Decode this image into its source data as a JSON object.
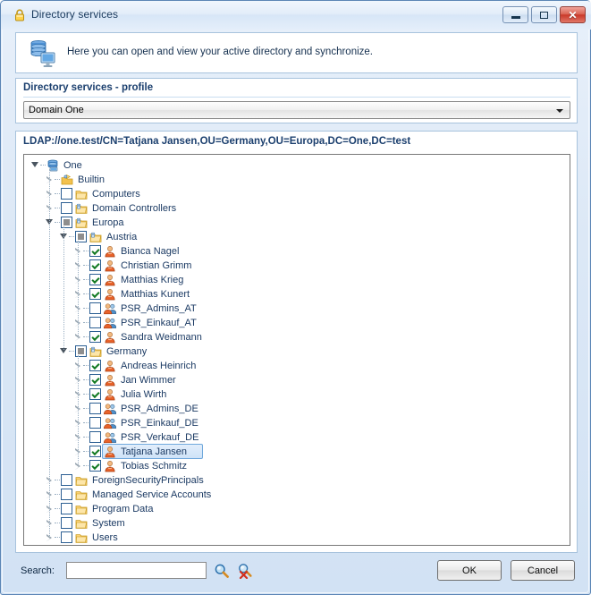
{
  "window": {
    "title": "Directory services",
    "title_icon": "lock-icon",
    "controls": {
      "minimize": "minimize-icon",
      "maximize": "maximize-icon",
      "close": "✕"
    }
  },
  "banner": {
    "icon": "database-server-monitor-icon",
    "text": "Here you can open and view your active directory and synchronize."
  },
  "profile_group": {
    "title": "Directory services - profile",
    "combo": {
      "value": "Domain One",
      "arrow": "chevron-down-icon"
    }
  },
  "ldap_group": {
    "title": "LDAP://one.test/CN=Tatjana Jansen,OU=Germany,OU=Europa,DC=One,DC=test"
  },
  "tree": [
    {
      "label": "One",
      "depth": 0,
      "icon": "server-icon",
      "checkbox": "none",
      "twisty": "expanded",
      "selected": false
    },
    {
      "label": "Builtin",
      "depth": 1,
      "icon": "builtin-folder-icon",
      "checkbox": "none",
      "twisty": "collapsed",
      "selected": false
    },
    {
      "label": "Computers",
      "depth": 1,
      "icon": "folder-icon",
      "checkbox": "unchecked",
      "twisty": "collapsed",
      "selected": false
    },
    {
      "label": "Domain Controllers",
      "depth": 1,
      "icon": "ou-folder-icon",
      "checkbox": "unchecked",
      "twisty": "collapsed",
      "selected": false
    },
    {
      "label": "Europa",
      "depth": 1,
      "icon": "ou-folder-icon",
      "checkbox": "partial",
      "twisty": "expanded",
      "selected": false
    },
    {
      "label": "Austria",
      "depth": 2,
      "icon": "ou-folder-icon",
      "checkbox": "partial",
      "twisty": "expanded",
      "selected": false
    },
    {
      "label": "Bianca Nagel",
      "depth": 3,
      "icon": "user-icon",
      "checkbox": "checked",
      "twisty": "collapsed",
      "selected": false
    },
    {
      "label": "Christian Grimm",
      "depth": 3,
      "icon": "user-icon",
      "checkbox": "checked",
      "twisty": "collapsed",
      "selected": false
    },
    {
      "label": "Matthias Krieg",
      "depth": 3,
      "icon": "user-icon",
      "checkbox": "checked",
      "twisty": "collapsed",
      "selected": false
    },
    {
      "label": "Matthias Kunert",
      "depth": 3,
      "icon": "user-icon",
      "checkbox": "checked",
      "twisty": "collapsed",
      "selected": false
    },
    {
      "label": "PSR_Admins_AT",
      "depth": 3,
      "icon": "group-icon",
      "checkbox": "unchecked",
      "twisty": "collapsed",
      "selected": false
    },
    {
      "label": "PSR_Einkauf_AT",
      "depth": 3,
      "icon": "group-icon",
      "checkbox": "unchecked",
      "twisty": "collapsed",
      "selected": false
    },
    {
      "label": "Sandra Weidmann",
      "depth": 3,
      "icon": "user-icon",
      "checkbox": "checked",
      "twisty": "collapsed",
      "selected": false
    },
    {
      "label": "Germany",
      "depth": 2,
      "icon": "ou-folder-icon",
      "checkbox": "partial",
      "twisty": "expanded",
      "selected": false
    },
    {
      "label": "Andreas Heinrich",
      "depth": 3,
      "icon": "user-icon",
      "checkbox": "checked",
      "twisty": "collapsed",
      "selected": false
    },
    {
      "label": "Jan Wimmer",
      "depth": 3,
      "icon": "user-icon",
      "checkbox": "checked",
      "twisty": "collapsed",
      "selected": false
    },
    {
      "label": "Julia Wirth",
      "depth": 3,
      "icon": "user-icon",
      "checkbox": "checked",
      "twisty": "collapsed",
      "selected": false
    },
    {
      "label": "PSR_Admins_DE",
      "depth": 3,
      "icon": "group-icon",
      "checkbox": "unchecked",
      "twisty": "collapsed",
      "selected": false
    },
    {
      "label": "PSR_Einkauf_DE",
      "depth": 3,
      "icon": "group-icon",
      "checkbox": "unchecked",
      "twisty": "collapsed",
      "selected": false
    },
    {
      "label": "PSR_Verkauf_DE",
      "depth": 3,
      "icon": "group-icon",
      "checkbox": "unchecked",
      "twisty": "collapsed",
      "selected": false
    },
    {
      "label": "Tatjana Jansen",
      "depth": 3,
      "icon": "user-icon",
      "checkbox": "checked",
      "twisty": "collapsed",
      "selected": true
    },
    {
      "label": "Tobias Schmitz",
      "depth": 3,
      "icon": "user-icon",
      "checkbox": "checked",
      "twisty": "collapsed",
      "selected": false
    },
    {
      "label": "ForeignSecurityPrincipals",
      "depth": 1,
      "icon": "folder-icon",
      "checkbox": "unchecked",
      "twisty": "collapsed",
      "selected": false
    },
    {
      "label": "Managed Service Accounts",
      "depth": 1,
      "icon": "folder-icon",
      "checkbox": "unchecked",
      "twisty": "collapsed",
      "selected": false
    },
    {
      "label": "Program Data",
      "depth": 1,
      "icon": "folder-icon",
      "checkbox": "unchecked",
      "twisty": "collapsed",
      "selected": false
    },
    {
      "label": "System",
      "depth": 1,
      "icon": "folder-icon",
      "checkbox": "unchecked",
      "twisty": "collapsed",
      "selected": false
    },
    {
      "label": "Users",
      "depth": 1,
      "icon": "folder-icon",
      "checkbox": "unchecked",
      "twisty": "collapsed",
      "selected": false
    }
  ],
  "footer": {
    "search_label": "Search:",
    "search_value": "",
    "search_placeholder": "",
    "search_icon": "magnifier-icon",
    "clear_search_icon": "magnifier-clear-icon",
    "ok_label": "OK",
    "cancel_label": "Cancel"
  },
  "colors": {
    "window_border": "#5b85b5",
    "group_title": "#1b3f6e",
    "tree_text": "#1b3a63",
    "checkbox_border": "#2c5f93",
    "check_mark": "#137a23",
    "selection_border": "#6fa8dc",
    "close_button": "#c9392a",
    "folder": "#f6c253"
  }
}
